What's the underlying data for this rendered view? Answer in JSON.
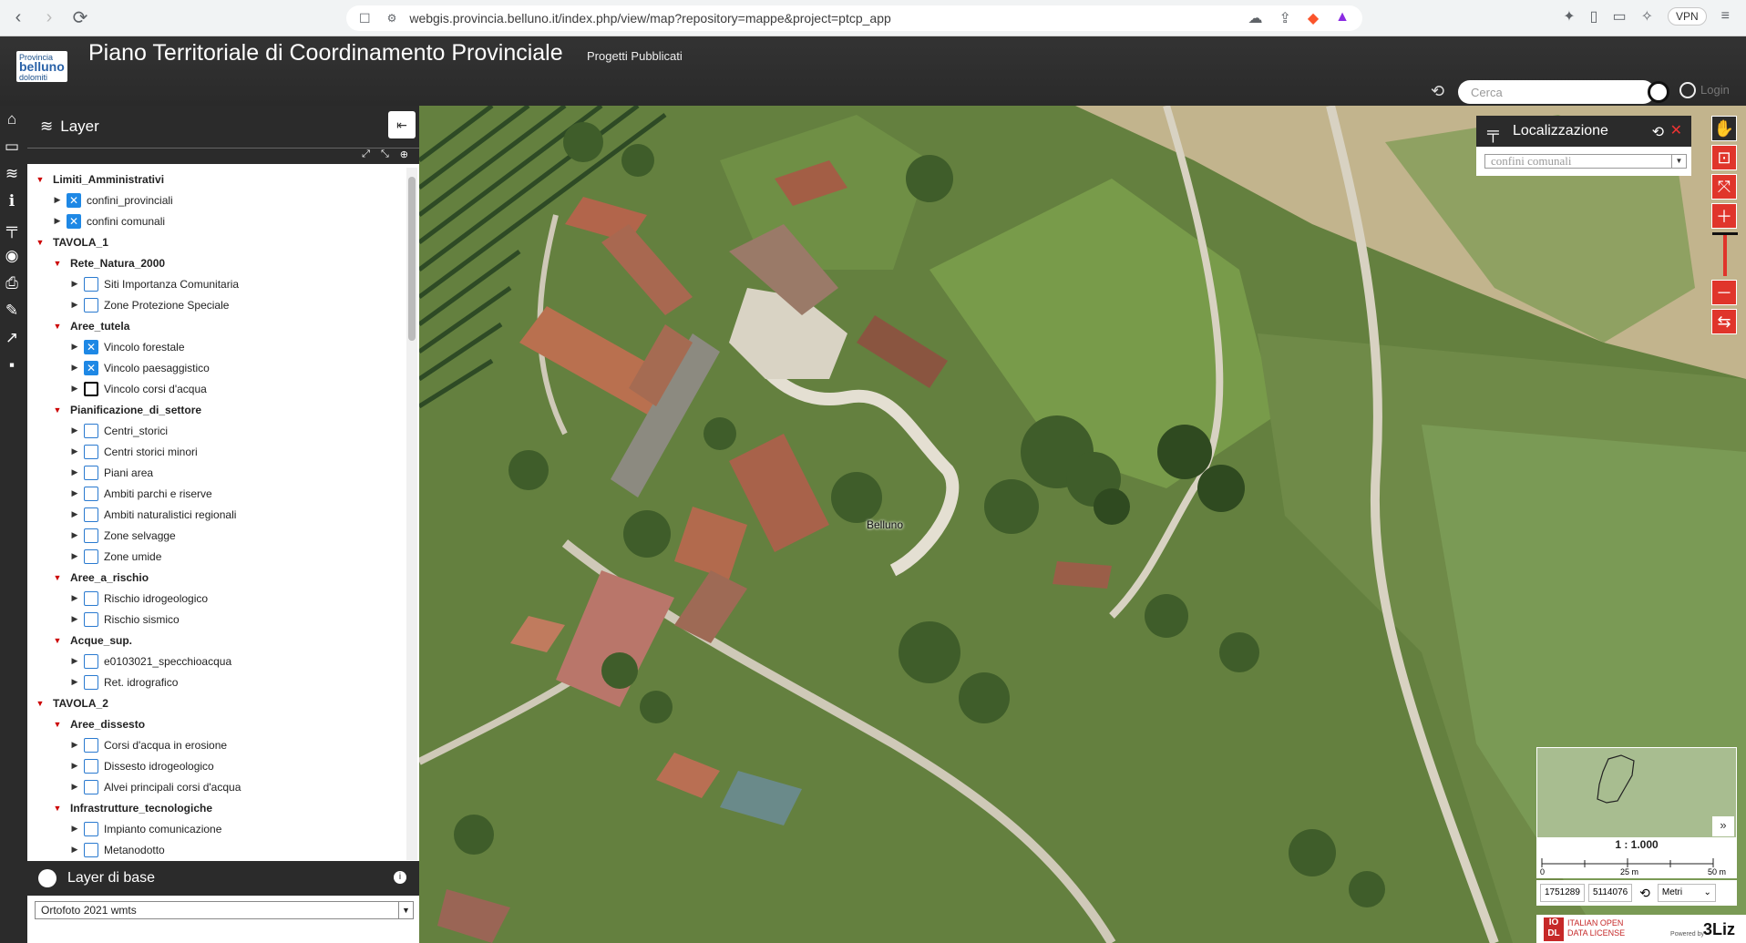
{
  "browser": {
    "url": "webgis.provincia.belluno.it/index.php/view/map?repository=mappe&project=ptcp_app",
    "vpn_label": "VPN"
  },
  "header": {
    "logo_lines": [
      "Provincia",
      "belluno",
      "dolomiti"
    ],
    "title": "Piano Territoriale di Coordinamento Provinciale",
    "subtitle": "Progetti Pubblicati",
    "search_placeholder": "Cerca",
    "login_label": "Login"
  },
  "layer_panel": {
    "title": "Layer",
    "rows": [
      {
        "label": "Limiti_Amministrativi",
        "level": 0,
        "group": true,
        "state": "none"
      },
      {
        "label": "confini_provinciali",
        "level": 1,
        "group": false,
        "state": "on"
      },
      {
        "label": "confini comunali",
        "level": 1,
        "group": false,
        "state": "on"
      },
      {
        "label": "TAVOLA_1",
        "level": 0,
        "group": false,
        "state": "none"
      },
      {
        "label": "Rete_Natura_2000",
        "level": 1,
        "group": true,
        "state": "none"
      },
      {
        "label": "Siti Importanza Comunitaria",
        "level": 2,
        "group": false,
        "state": "off"
      },
      {
        "label": "Zone Protezione Speciale",
        "level": 2,
        "group": false,
        "state": "off"
      },
      {
        "label": "Aree_tutela",
        "level": 1,
        "group": true,
        "state": "none"
      },
      {
        "label": "Vincolo forestale",
        "level": 2,
        "group": false,
        "state": "on"
      },
      {
        "label": "Vincolo paesaggistico",
        "level": 2,
        "group": false,
        "state": "on"
      },
      {
        "label": "Vincolo corsi d'acqua",
        "level": 2,
        "group": false,
        "state": "focus"
      },
      {
        "label": "Pianificazione_di_settore",
        "level": 1,
        "group": true,
        "state": "none"
      },
      {
        "label": "Centri_storici",
        "level": 2,
        "group": false,
        "state": "off"
      },
      {
        "label": "Centri storici minori",
        "level": 2,
        "group": false,
        "state": "off"
      },
      {
        "label": "Piani area",
        "level": 2,
        "group": false,
        "state": "off"
      },
      {
        "label": "Ambiti parchi e riserve",
        "level": 2,
        "group": false,
        "state": "off"
      },
      {
        "label": "Ambiti naturalistici regionali",
        "level": 2,
        "group": false,
        "state": "off"
      },
      {
        "label": "Zone selvagge",
        "level": 2,
        "group": false,
        "state": "off"
      },
      {
        "label": "Zone umide",
        "level": 2,
        "group": false,
        "state": "off"
      },
      {
        "label": "Aree_a_rischio",
        "level": 1,
        "group": true,
        "state": "none"
      },
      {
        "label": "Rischio idrogeologico",
        "level": 2,
        "group": false,
        "state": "off"
      },
      {
        "label": "Rischio sismico",
        "level": 2,
        "group": false,
        "state": "off"
      },
      {
        "label": "Acque_sup.",
        "level": 1,
        "group": true,
        "state": "none"
      },
      {
        "label": "e0103021_specchioacqua",
        "level": 2,
        "group": false,
        "state": "off"
      },
      {
        "label": "Ret. idrografico",
        "level": 2,
        "group": false,
        "state": "off"
      },
      {
        "label": "TAVOLA_2",
        "level": 0,
        "group": false,
        "state": "none"
      },
      {
        "label": "Aree_dissesto",
        "level": 1,
        "group": true,
        "state": "none"
      },
      {
        "label": "Corsi d'acqua in erosione",
        "level": 2,
        "group": false,
        "state": "off"
      },
      {
        "label": "Dissesto idrogeologico",
        "level": 2,
        "group": false,
        "state": "off"
      },
      {
        "label": "Alvei principali corsi d'acqua",
        "level": 2,
        "group": false,
        "state": "off"
      },
      {
        "label": "Infrastrutture_tecnologiche",
        "level": 1,
        "group": true,
        "state": "none"
      },
      {
        "label": "Impianto comunicazione",
        "level": 2,
        "group": false,
        "state": "off"
      },
      {
        "label": "Metanodotto",
        "level": 2,
        "group": false,
        "state": "off"
      }
    ]
  },
  "base_layer": {
    "title": "Layer di base",
    "selected": "Ortofoto 2021 wmts"
  },
  "map": {
    "place_label": "Belluno"
  },
  "localizzazione": {
    "title": "Localizzazione",
    "selected": "confini comunali"
  },
  "scale": {
    "text": "1 : 1.000",
    "ticks": [
      "0",
      "25 m",
      "50 m"
    ]
  },
  "coords": {
    "x": "1751289",
    "y": "5114076",
    "units": "Metri"
  },
  "licence": {
    "badge_lines": [
      "IO",
      "DL"
    ],
    "text_lines": [
      "ITALIAN OPEN",
      "DATA LICENSE"
    ],
    "powered_by": "Powered by",
    "brand": "3Liz"
  },
  "colors": {
    "accent_red": "#e0352b",
    "checkbox_blue": "#1e88e5",
    "dark_bar": "#2b2b2b"
  }
}
